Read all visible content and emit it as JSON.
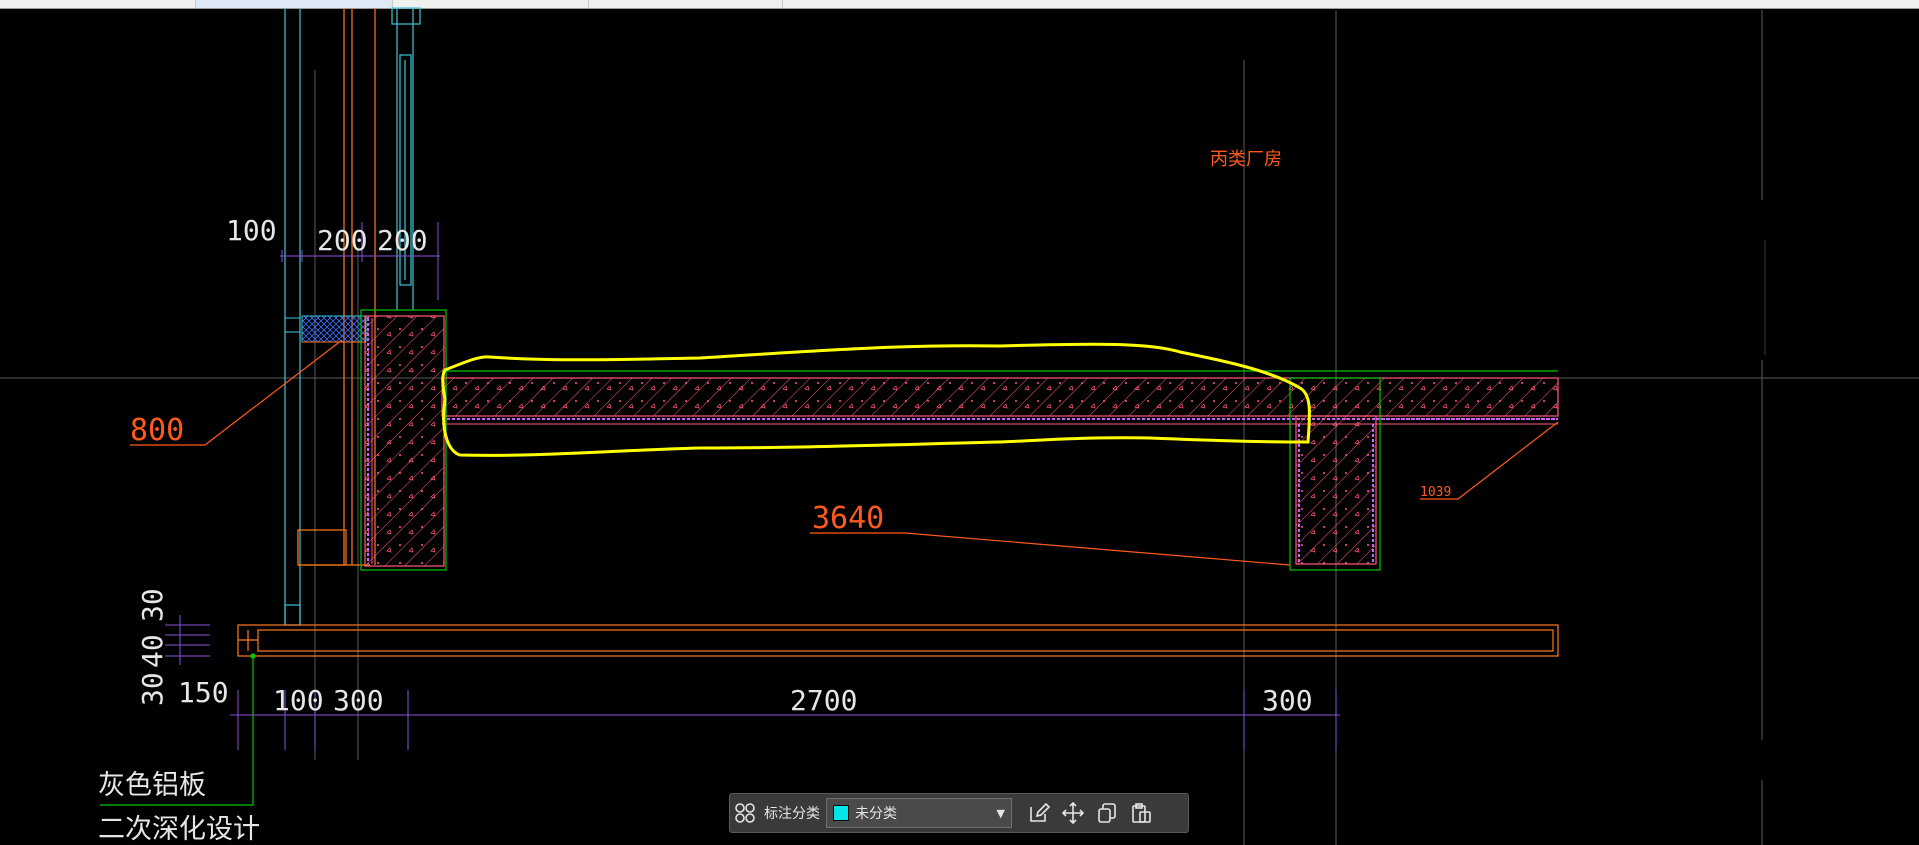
{
  "drawing": {
    "title_text": "丙类厂房",
    "dims_top": [
      "100",
      "200",
      "200"
    ],
    "dims_left": [
      "30",
      "40",
      "30",
      "150"
    ],
    "dims_bottom": [
      "100",
      "300",
      "2700",
      "300"
    ],
    "leaders": [
      "800",
      "3640",
      "1039"
    ],
    "notes": [
      "灰色铝板",
      "二次深化设计"
    ]
  },
  "toolbar": {
    "category_label": "标注分类",
    "category_value": "未分类",
    "category_color": "#00e5e5",
    "icons": [
      "grid-icon",
      "edit-icon",
      "move-icon",
      "copy-icon",
      "paste-icon"
    ]
  },
  "colors": {
    "background": "#000000",
    "markup": "#ffff00",
    "dimension": "#8c50dc",
    "leader": "#ff5a1e",
    "concrete": "#ff5a78",
    "outline": "#00c800",
    "glass": "#3cc8dc"
  }
}
